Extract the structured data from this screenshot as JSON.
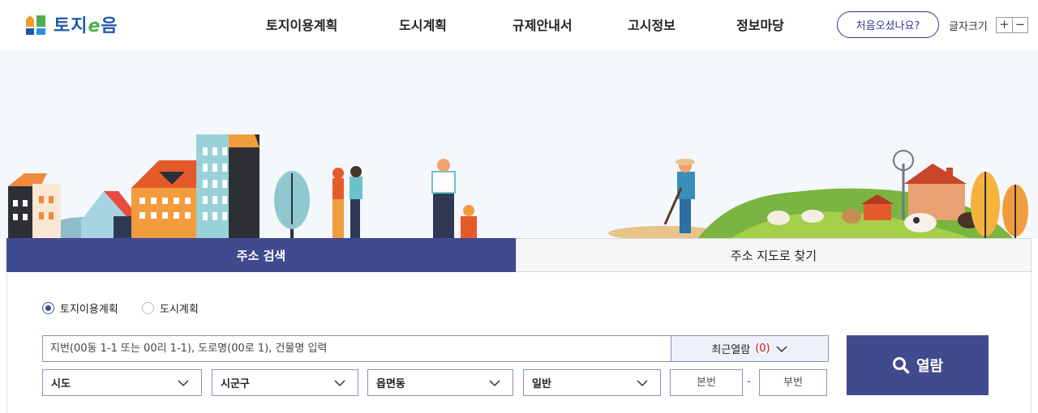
{
  "header": {
    "logo_text_1": "토지",
    "logo_text_e": "e",
    "logo_text_2": "음",
    "nav": [
      "토지이용계획",
      "도시계획",
      "규제안내서",
      "고시정보",
      "정보마당"
    ],
    "first_visit_label": "처음오셨나요?",
    "font_size_label": "글자크기",
    "font_plus": "+",
    "font_minus": "−"
  },
  "tabs": {
    "address_search": "주소 검색",
    "map_search": "주소 지도로 찾기"
  },
  "search": {
    "radio_land_use": "토지이용계획",
    "radio_urban": "도시계획",
    "selected_radio": "토지이용계획",
    "placeholder": "지번(00동 1-1 또는 00리 1-1), 도로명(00로 1), 건물명 입력",
    "recent_label": "최근열람",
    "recent_count": "(0)",
    "view_button": "열람",
    "sido": "시도",
    "sigungu": "시군구",
    "eupmyeondong": "읍면동",
    "land_type": "일반",
    "bonbun_placeholder": "본번",
    "dash": "-",
    "bubun_placeholder": "부번"
  },
  "colors": {
    "primary": "#3f4a8f",
    "accent_red": "#d0141b",
    "logo_blue": "#1f5aa8",
    "logo_green": "#4cae4f"
  }
}
